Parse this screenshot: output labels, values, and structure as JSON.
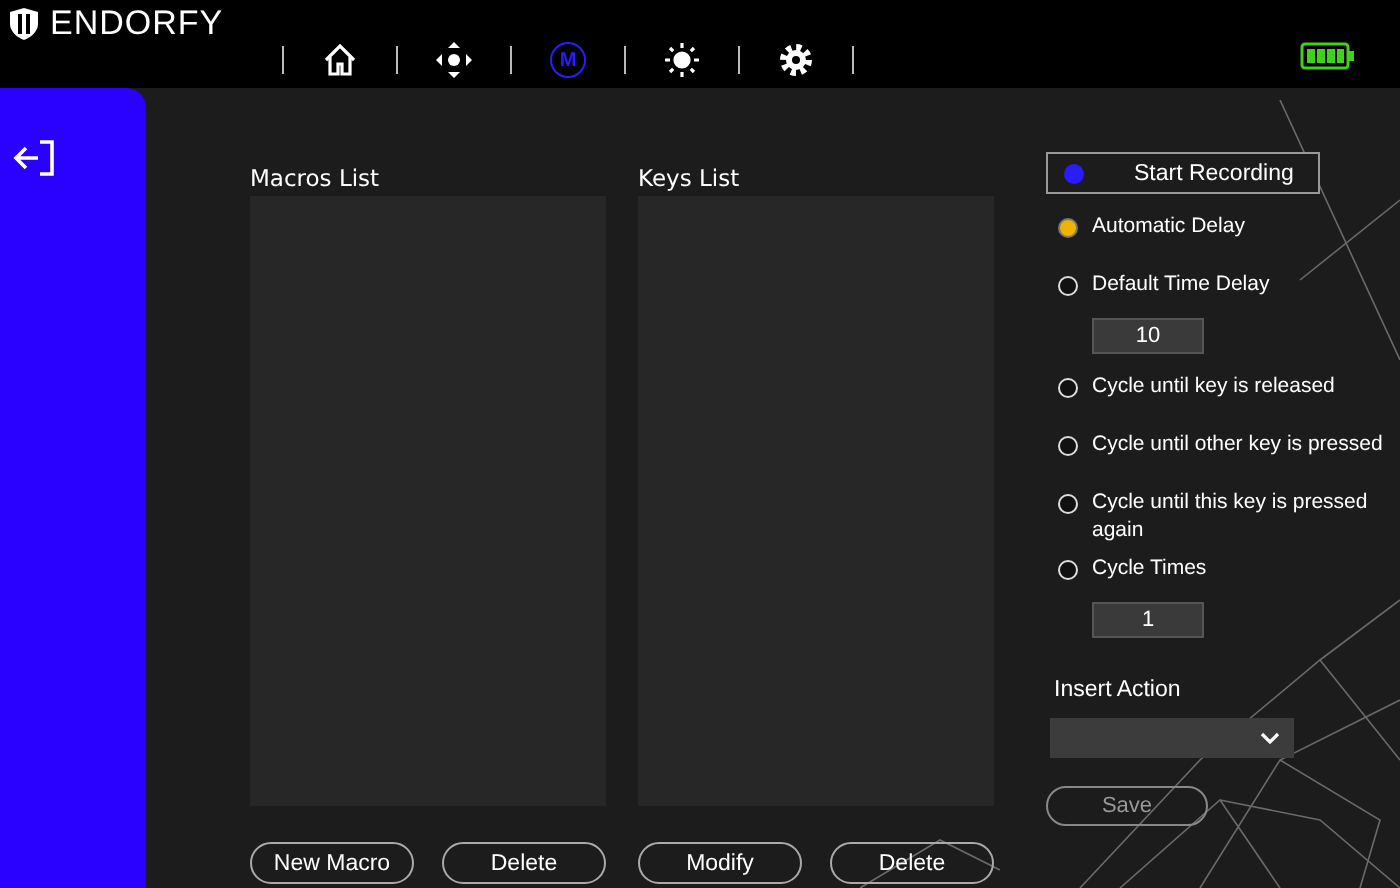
{
  "brand": {
    "name": "ENDORFY"
  },
  "nav": [
    {
      "kind": "home",
      "selected": false
    },
    {
      "kind": "dpad",
      "selected": false
    },
    {
      "kind": "macro",
      "label": "M",
      "selected": true
    },
    {
      "kind": "brightness",
      "selected": false
    },
    {
      "kind": "settings",
      "selected": false
    }
  ],
  "macros_list": {
    "title": "Macros List",
    "buttons": [
      "New Macro",
      "Delete"
    ]
  },
  "keys_list": {
    "title": "Keys List",
    "buttons": [
      "Modify",
      "Delete"
    ]
  },
  "record_button": {
    "label": "Start Recording"
  },
  "options": [
    {
      "label": "Automatic  Delay",
      "selected": true
    },
    {
      "label": "Default Time Delay",
      "selected": false,
      "value": "10"
    },
    {
      "label": "Cycle until key is released",
      "selected": false
    },
    {
      "label": "Cycle until other key is pressed",
      "selected": false
    },
    {
      "label": "Cycle until this key is pressed again",
      "selected": false
    },
    {
      "label": "Cycle Times",
      "selected": false,
      "value": "1"
    }
  ],
  "insert_action": {
    "label": "Insert Action"
  },
  "save_button": {
    "label": "Save"
  }
}
